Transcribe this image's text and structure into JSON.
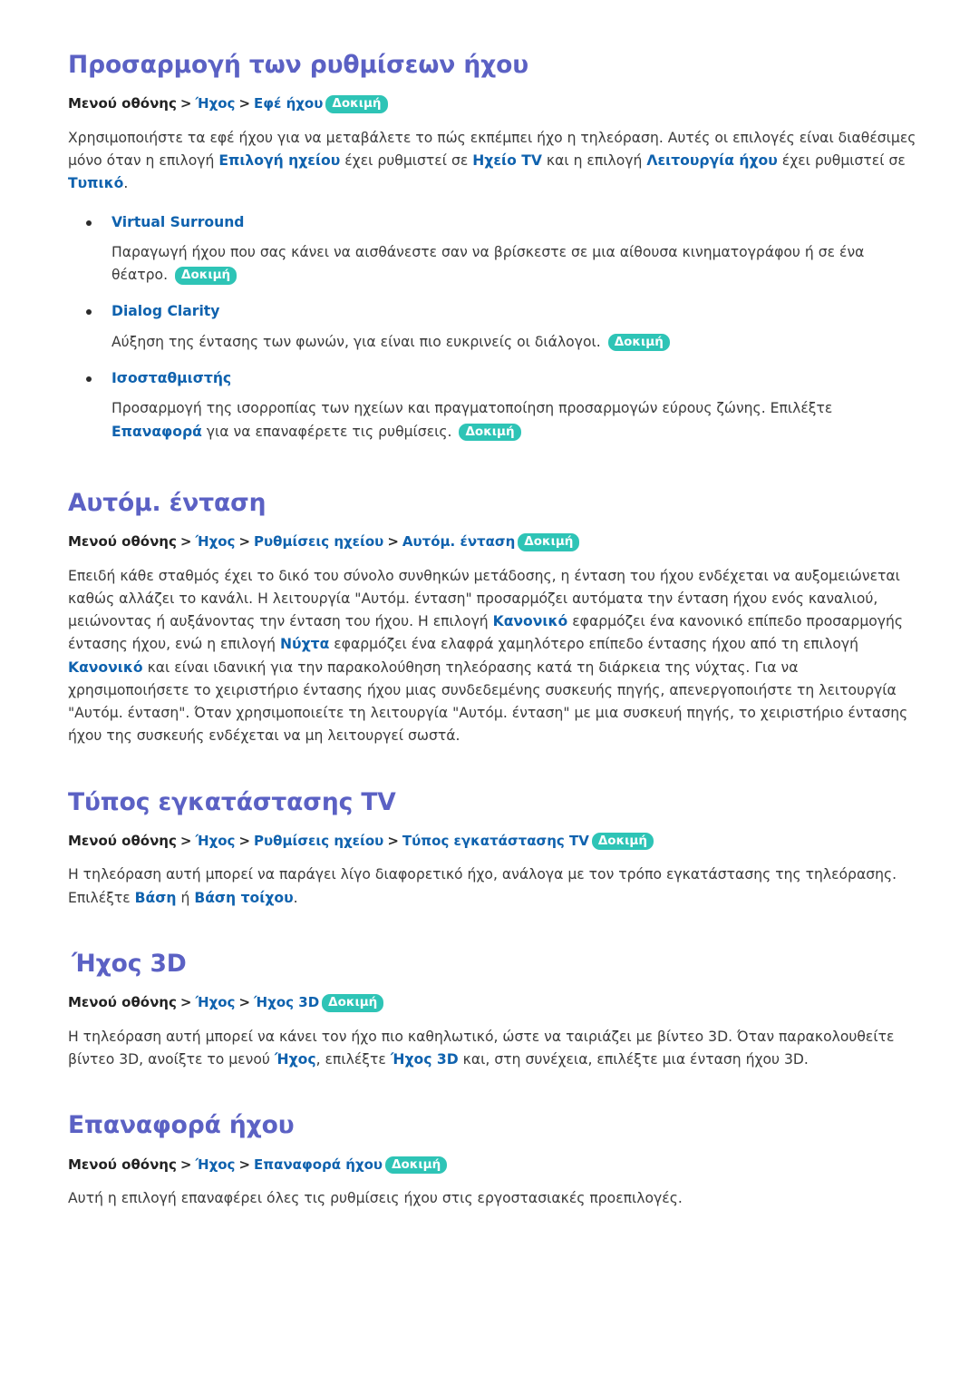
{
  "page": {
    "background": "#ffffff",
    "heading_color": "#5b61c4",
    "link_color": "#0f62ae",
    "badge_color": "#2ec4b6",
    "body_color": "#3b3b3b"
  },
  "badge_label": "Δοκιμή",
  "breadcrumb_root": "Μενού οθόνης",
  "breadcrumb_separator": ">",
  "sections": {
    "sound_settings": {
      "title": "Προσαρμογή των ρυθμίσεων ήχου",
      "breadcrumb": {
        "root": "Μενού οθόνης",
        "crumb1": "Ήχος",
        "crumb2": "Εφέ ήχου",
        "badge": "Δοκιμή"
      },
      "intro": {
        "t1": "Χρησιμοποιήστε τα εφέ ήχου για να μεταβάλετε το πώς εκπέμπει ήχο η τηλεόραση. Αυτές οι επιλογές είναι διαθέσιμες μόνο όταν η επιλογή ",
        "em1": "Επιλογή ηχείου",
        "t2": " έχει ρυθμιστεί σε ",
        "em2": "Ηχείο TV",
        "t3": " και η επιλογή ",
        "em3": "Λειτουργία ήχου",
        "t4": " έχει ρυθμιστεί σε ",
        "em4": "Τυπικό",
        "t5": "."
      },
      "bullets": [
        {
          "label": "Virtual Surround",
          "desc_before": "Παραγωγή ήχου που σας κάνει να αισθάνεστε σαν να βρίσκεστε σε μια αίθουσα κινηματογράφου ή σε ένα θέατρο. ",
          "badge": "Δοκιμή"
        },
        {
          "label": "Dialog Clarity",
          "desc_before": "Αύξηση της έντασης των φωνών, για είναι πιο ευκρινείς οι διάλογοι. ",
          "badge": "Δοκιμή"
        },
        {
          "label": "Ισοσταθμιστής",
          "desc_before": "Προσαρμογή της ισορροπίας των ηχείων και πραγματοποίηση προσαρμογών εύρους ζώνης. Επιλέξτε ",
          "desc_em": "Επαναφορά",
          "desc_after": " για να επαναφέρετε τις ρυθμίσεις. ",
          "badge": "Δοκιμή"
        }
      ]
    },
    "auto_volume": {
      "title": "Αυτόμ. ένταση",
      "breadcrumb": {
        "root": "Μενού οθόνης",
        "crumb1": "Ήχος",
        "crumb2": "Ρυθμίσεις ηχείου",
        "crumb3": "Αυτόμ. ένταση",
        "badge": "Δοκιμή"
      },
      "body": {
        "t1": "Επειδή κάθε σταθμός έχει το δικό του σύνολο συνθηκών μετάδοσης, η ένταση του ήχου ενδέχεται να αυξομειώνεται καθώς αλλάζει το κανάλι. Η λειτουργία \"Αυτόμ. ένταση\" προσαρμόζει αυτόματα την ένταση ήχου ενός καναλιού, μειώνοντας ή αυξάνοντας την ένταση του ήχου. Η επιλογή ",
        "em1": "Κανονικό",
        "t2": " εφαρμόζει ένα κανονικό επίπεδο προσαρμογής έντασης ήχου, ενώ η επιλογή ",
        "em2": "Νύχτα",
        "t3": " εφαρμόζει ένα ελαφρά χαμηλότερο επίπεδο έντασης ήχου από τη επιλογή ",
        "em3": "Κανονικό",
        "t4": " και είναι ιδανική για την παρακολούθηση τηλεόρασης κατά τη διάρκεια της νύχτας. Για να χρησιμοποιήσετε το χειριστήριο έντασης ήχου μιας συνδεδεμένης συσκευής πηγής, απενεργοποιήστε τη λειτουργία \"Αυτόμ. ένταση\". Όταν χρησιμοποιείτε τη λειτουργία \"Αυτόμ. ένταση\" με μια συσκευή πηγής, το χειριστήριο έντασης ήχου της συσκευής ενδέχεται να μη λειτουργεί σωστά."
      }
    },
    "tv_install_type": {
      "title": "Τύπος εγκατάστασης TV",
      "breadcrumb": {
        "root": "Μενού οθόνης",
        "crumb1": "Ήχος",
        "crumb2": "Ρυθμίσεις ηχείου",
        "crumb3": "Τύπος εγκατάστασης TV",
        "badge": "Δοκιμή"
      },
      "body": {
        "t1": "Η τηλεόραση αυτή μπορεί να παράγει λίγο διαφορετικό ήχο, ανάλογα με τον τρόπο εγκατάστασης της τηλεόρασης. Επιλέξτε ",
        "em1": "Βάση",
        "t2": " ή ",
        "em2": "Βάση τοίχου",
        "t3": "."
      }
    },
    "sound_3d": {
      "title": "Ήχος 3D",
      "breadcrumb": {
        "root": "Μενού οθόνης",
        "crumb1": "Ήχος",
        "crumb2": "Ήχος 3D",
        "badge": "Δοκιμή"
      },
      "body": {
        "t1": "Η τηλεόραση αυτή μπορεί να κάνει τον ήχο πιο καθηλωτικό, ώστε να ταιριάζει με βίντεο 3D. Όταν παρακολουθείτε βίντεο 3D, ανοίξτε το μενού ",
        "em1": "Ήχος",
        "t2": ", επιλέξτε ",
        "em2": "Ήχος 3D",
        "t3": " και, στη συνέχεια, επιλέξτε μια ένταση ήχου 3D."
      }
    },
    "sound_reset": {
      "title": "Επαναφορά ήχου",
      "breadcrumb": {
        "root": "Μενού οθόνης",
        "crumb1": "Ήχος",
        "crumb2": "Επαναφορά ήχου",
        "badge": "Δοκιμή"
      },
      "body": {
        "t1": "Αυτή η επιλογή επαναφέρει όλες τις ρυθμίσεις ήχου στις εργοστασιακές προεπιλογές."
      }
    }
  }
}
